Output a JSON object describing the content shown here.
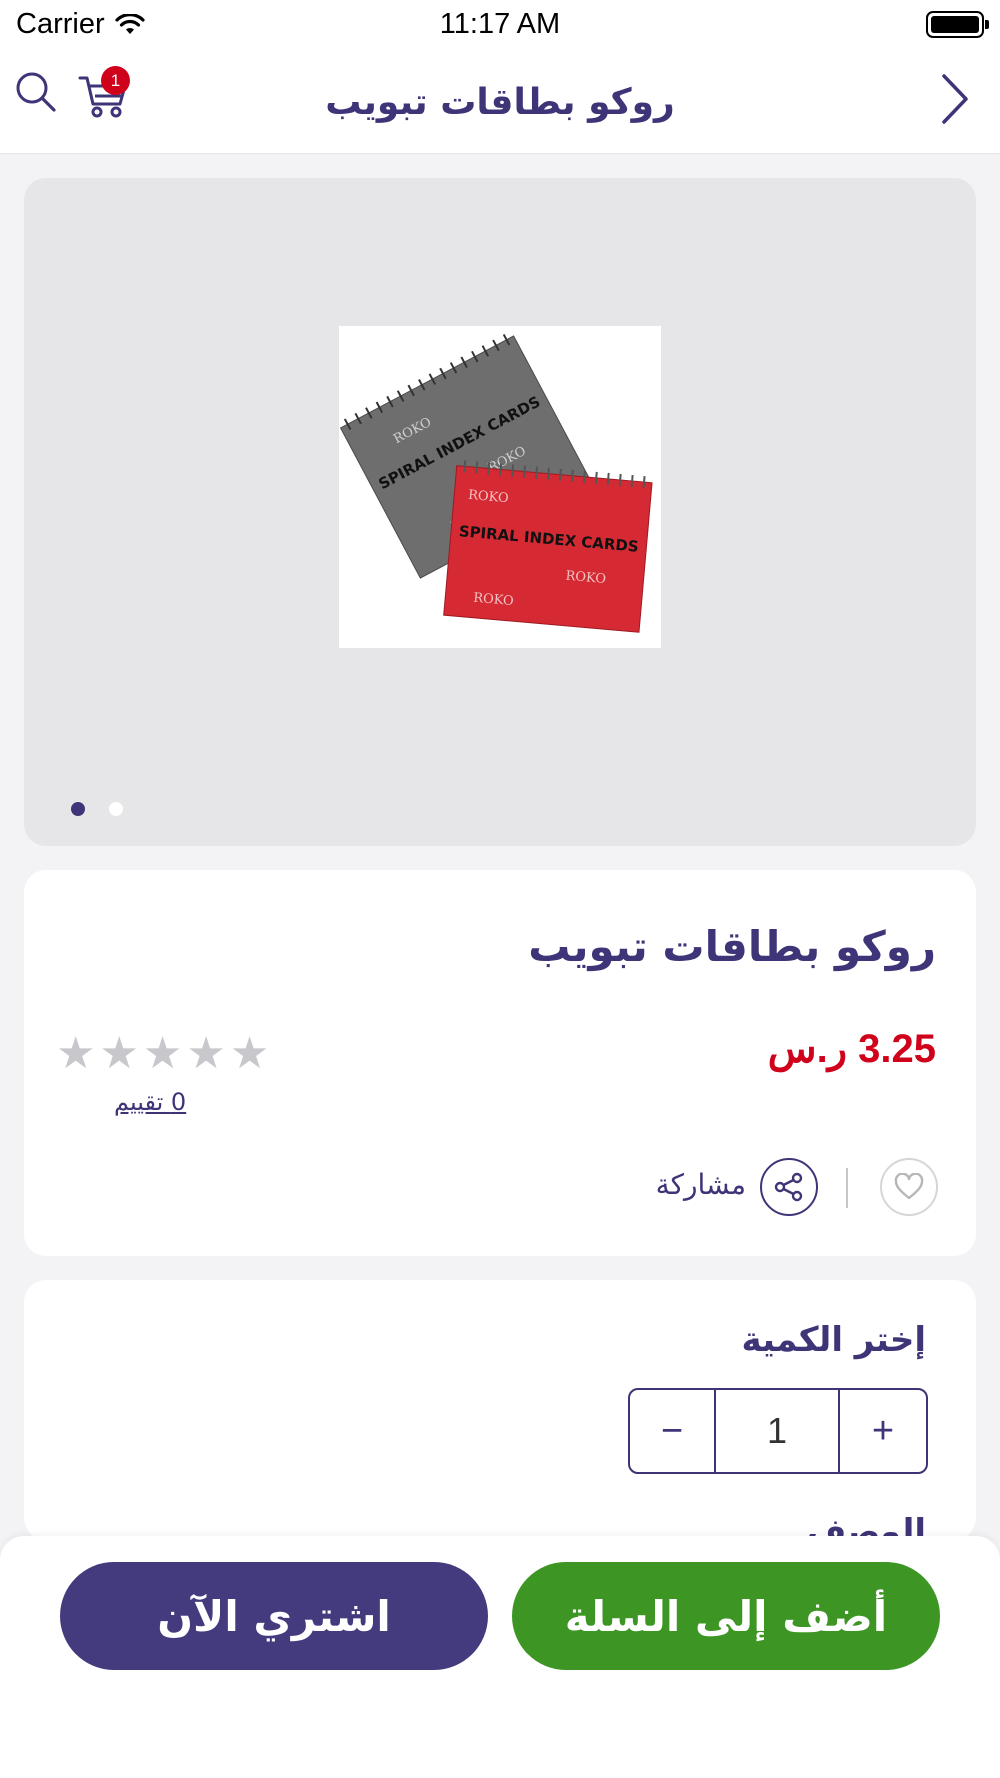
{
  "status_bar": {
    "carrier": "Carrier",
    "time": "11:17 AM"
  },
  "nav": {
    "title": "روكو بطاقات تبويب",
    "cart_count": "1",
    "icons": [
      "search-icon",
      "cart-icon",
      "chevron-right-icon"
    ]
  },
  "gallery": {
    "image_text": "SPIRAL INDEX CARDS",
    "brand_text": "ROKO",
    "slide_count": 2,
    "active_slide": 1
  },
  "product": {
    "title": "روكو بطاقات تبويب",
    "price": "3.25 ر.س",
    "rating_stars": 0,
    "rating_label": "0  تقييم",
    "share_label": "مشاركة"
  },
  "quantity": {
    "title": "إختر الكمية",
    "value": "1",
    "minus": "−",
    "plus": "+"
  },
  "description": {
    "title": "الوصف"
  },
  "actions": {
    "buy_now": "اشتري الآن",
    "add_to_cart": "أضف إلى السلة"
  },
  "colors": {
    "primary": "#3d3577",
    "price_red": "#d0021b",
    "cart_green": "#3d9624",
    "buy_purple": "#433b7e",
    "badge_red": "#d0021b"
  }
}
